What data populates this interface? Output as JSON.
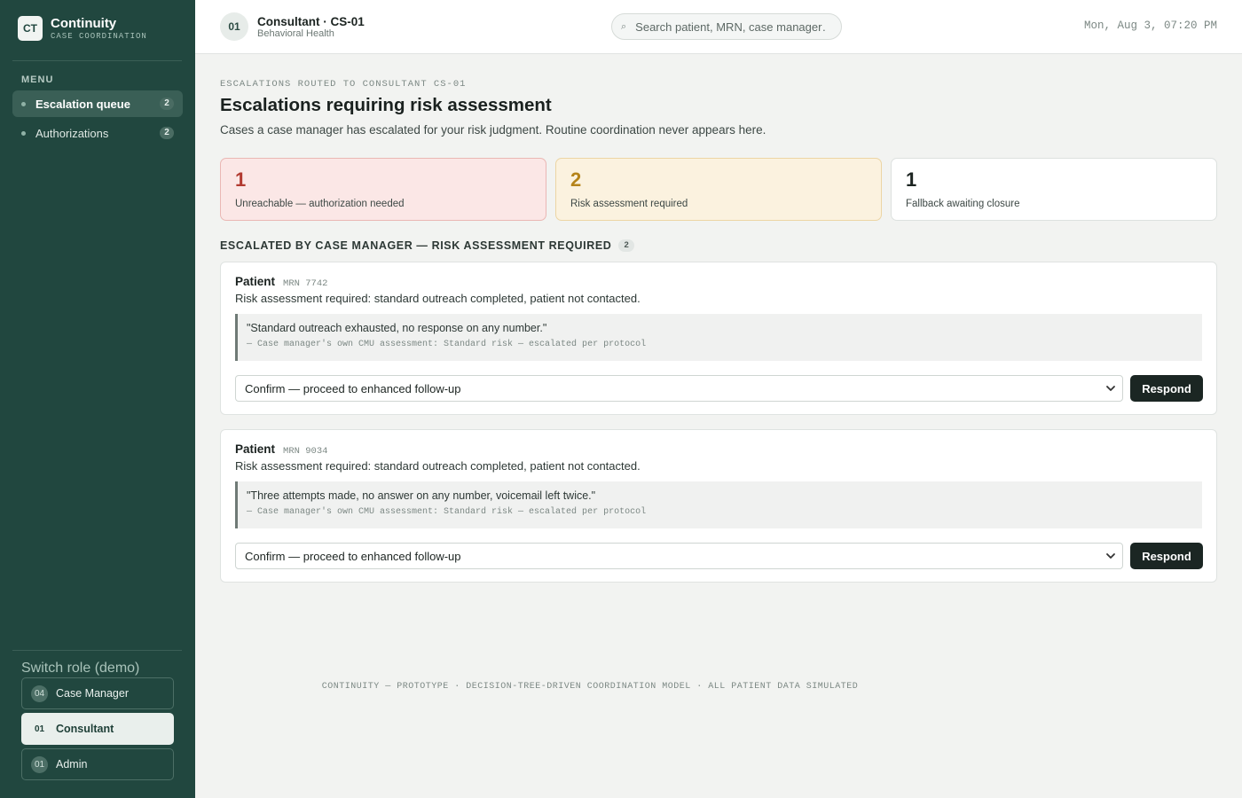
{
  "brand": {
    "logo": "CT",
    "title": "Continuity",
    "subtitle": "CASE COORDINATION"
  },
  "sidebar": {
    "menu_label": "MENU",
    "items": [
      {
        "label": "Escalation queue",
        "count": "2",
        "active": true
      },
      {
        "label": "Authorizations",
        "count": "2",
        "active": false
      }
    ],
    "switch_label": "Switch role (demo)",
    "roles": [
      {
        "num": "04",
        "label": "Case Manager",
        "active": false
      },
      {
        "num": "01",
        "label": "Consultant",
        "active": true
      },
      {
        "num": "01",
        "label": "Admin",
        "active": false
      }
    ]
  },
  "header": {
    "user_badge": "01",
    "user_name": "Consultant · CS-01",
    "user_dept": "Behavioral Health",
    "search_icon": "⌕",
    "search_placeholder": "Search patient, MRN, case manager…",
    "clock": "Mon, Aug 3, 07:20 PM"
  },
  "main": {
    "eyebrow": "ESCALATIONS ROUTED TO CONSULTANT CS-01",
    "title": "Escalations requiring risk assessment",
    "description": "Cases a case manager has escalated for your risk judgment. Routine coordination never appears here.",
    "stats": [
      {
        "value": "1",
        "label": "Unreachable — authorization needed",
        "tone": "red"
      },
      {
        "value": "2",
        "label": "Risk assessment required",
        "tone": "amber"
      },
      {
        "value": "1",
        "label": "Fallback awaiting closure",
        "tone": "white"
      }
    ],
    "section_title": "ESCALATED BY CASE MANAGER — RISK ASSESSMENT REQUIRED",
    "section_count": "2",
    "cases": [
      {
        "patient_label": "Patient",
        "mrn": "MRN 7742",
        "status": "Risk assessment required: standard outreach completed, patient not contacted.",
        "quote": "\"Standard outreach exhausted, no response on any number.\"",
        "attribution": "— Case manager's own CMU assessment: Standard risk — escalated per protocol",
        "selected_option": "Confirm — proceed to enhanced follow-up",
        "respond_label": "Respond"
      },
      {
        "patient_label": "Patient",
        "mrn": "MRN 9034",
        "status": "Risk assessment required: standard outreach completed, patient not contacted.",
        "quote": "\"Three attempts made, no answer on any number, voicemail left twice.\"",
        "attribution": "— Case manager's own CMU assessment: Standard risk — escalated per protocol",
        "selected_option": "Confirm — proceed to enhanced follow-up",
        "respond_label": "Respond"
      }
    ]
  },
  "footer": "CONTINUITY — PROTOTYPE · DECISION-TREE-DRIVEN COORDINATION MODEL · ALL PATIENT DATA SIMULATED",
  "colors": {
    "sidebar_bg": "#21473f",
    "alert_red": "#b23a30",
    "alert_amber": "#b5841a",
    "button_dark": "#1b2623"
  }
}
